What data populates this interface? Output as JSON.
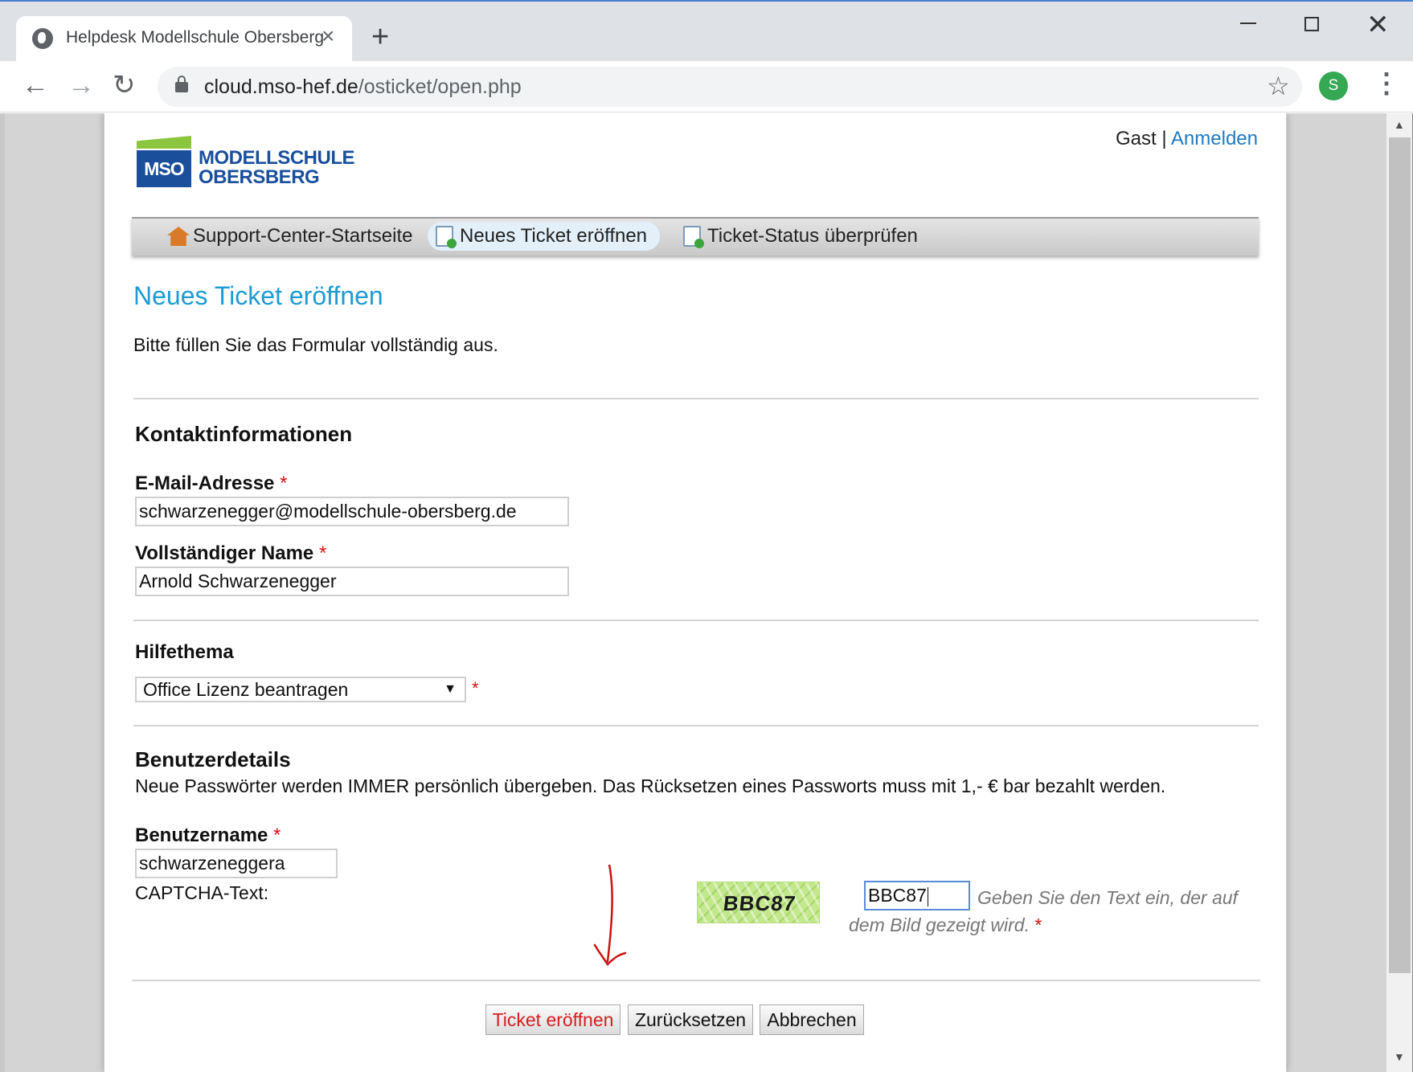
{
  "browser": {
    "tab_title": "Helpdesk Modellschule Obersberg",
    "new_tab_icon": "plus-icon",
    "url_host": "cloud.mso-hef.de",
    "url_path": "/osticket/open.php",
    "profile_initial": "S",
    "colors": {
      "profile": "#34a853",
      "tabbar": "#dee1e6"
    }
  },
  "header": {
    "logo_box_text": "MSO",
    "logo_line1": "MODELLSCHULE",
    "logo_line2": "OBERSBERG",
    "user_guest": "Gast",
    "user_separator": "|",
    "login_link": "Anmelden"
  },
  "nav": {
    "items": [
      {
        "label": "Support-Center-Startseite",
        "icon": "home-icon",
        "active": false
      },
      {
        "label": "Neues Ticket eröffnen",
        "icon": "new-ticket-icon",
        "active": true
      },
      {
        "label": "Ticket-Status überprüfen",
        "icon": "ticket-status-icon",
        "active": false
      }
    ]
  },
  "form": {
    "title": "Neues Ticket eröffnen",
    "intro": "Bitte füllen Sie das Formular vollständig aus.",
    "contact_heading": "Kontaktinformationen",
    "email_label": "E-Mail-Adresse",
    "email_value": "schwarzenegger@modellschule-obersberg.de",
    "name_label": "Vollständiger Name",
    "name_value": "Arnold Schwarzenegger",
    "topic_label": "Hilfethema",
    "topic_value": "Office Lizenz beantragen",
    "user_heading": "Benutzerdetails",
    "user_desc": "Neue Passwörter werden IMMER persönlich übergeben. Das Rücksetzen eines Passworts muss mit 1,- € bar bezahlt werden.",
    "username_label": "Benutzername",
    "username_value": "schwarzeneggera",
    "captcha_label": "CAPTCHA-Text:",
    "captcha_image_text": "BBC87",
    "captcha_value": "BBC87",
    "captcha_hint": "Geben Sie den Text ein, der auf dem Bild gezeigt wird.",
    "required_marker": "*"
  },
  "buttons": {
    "submit": "Ticket eröffnen",
    "reset": "Zurücksetzen",
    "cancel": "Abbrechen"
  },
  "colors": {
    "heading_blue": "#1d9bd4",
    "link_blue": "#1e7bc2",
    "required_red": "#d11111",
    "submit_text_red": "#d32020",
    "annotation_arrow": "#cc1111"
  }
}
